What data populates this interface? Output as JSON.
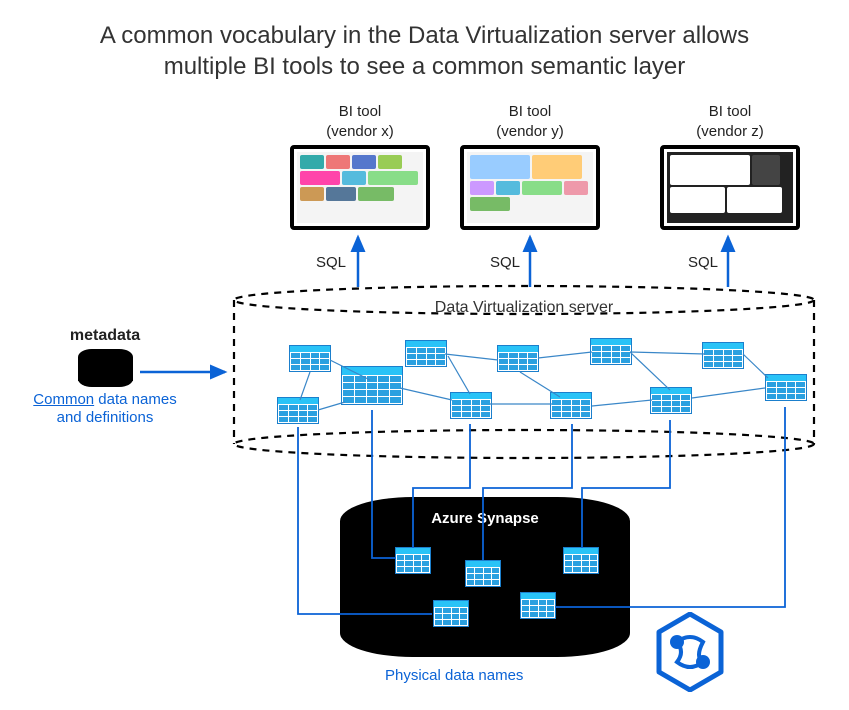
{
  "title": "A common vocabulary in the Data Virtualization server allows multiple BI tools to see a common semantic layer",
  "bi_tools": [
    {
      "line1": "BI tool",
      "line2": "(vendor x)",
      "sql": "SQL"
    },
    {
      "line1": "BI tool",
      "line2": "(vendor y)",
      "sql": "SQL"
    },
    {
      "line1": "BI tool",
      "line2": "(vendor z)",
      "sql": "SQL"
    }
  ],
  "metadata": {
    "heading": "metadata",
    "link_text": "Common",
    "rest_text_1": " data names",
    "rest_text_2": "and definitions"
  },
  "dv_server_label": "Data Virtualization server",
  "synapse_label": "Azure Synapse",
  "physical_label": "Physical data names"
}
